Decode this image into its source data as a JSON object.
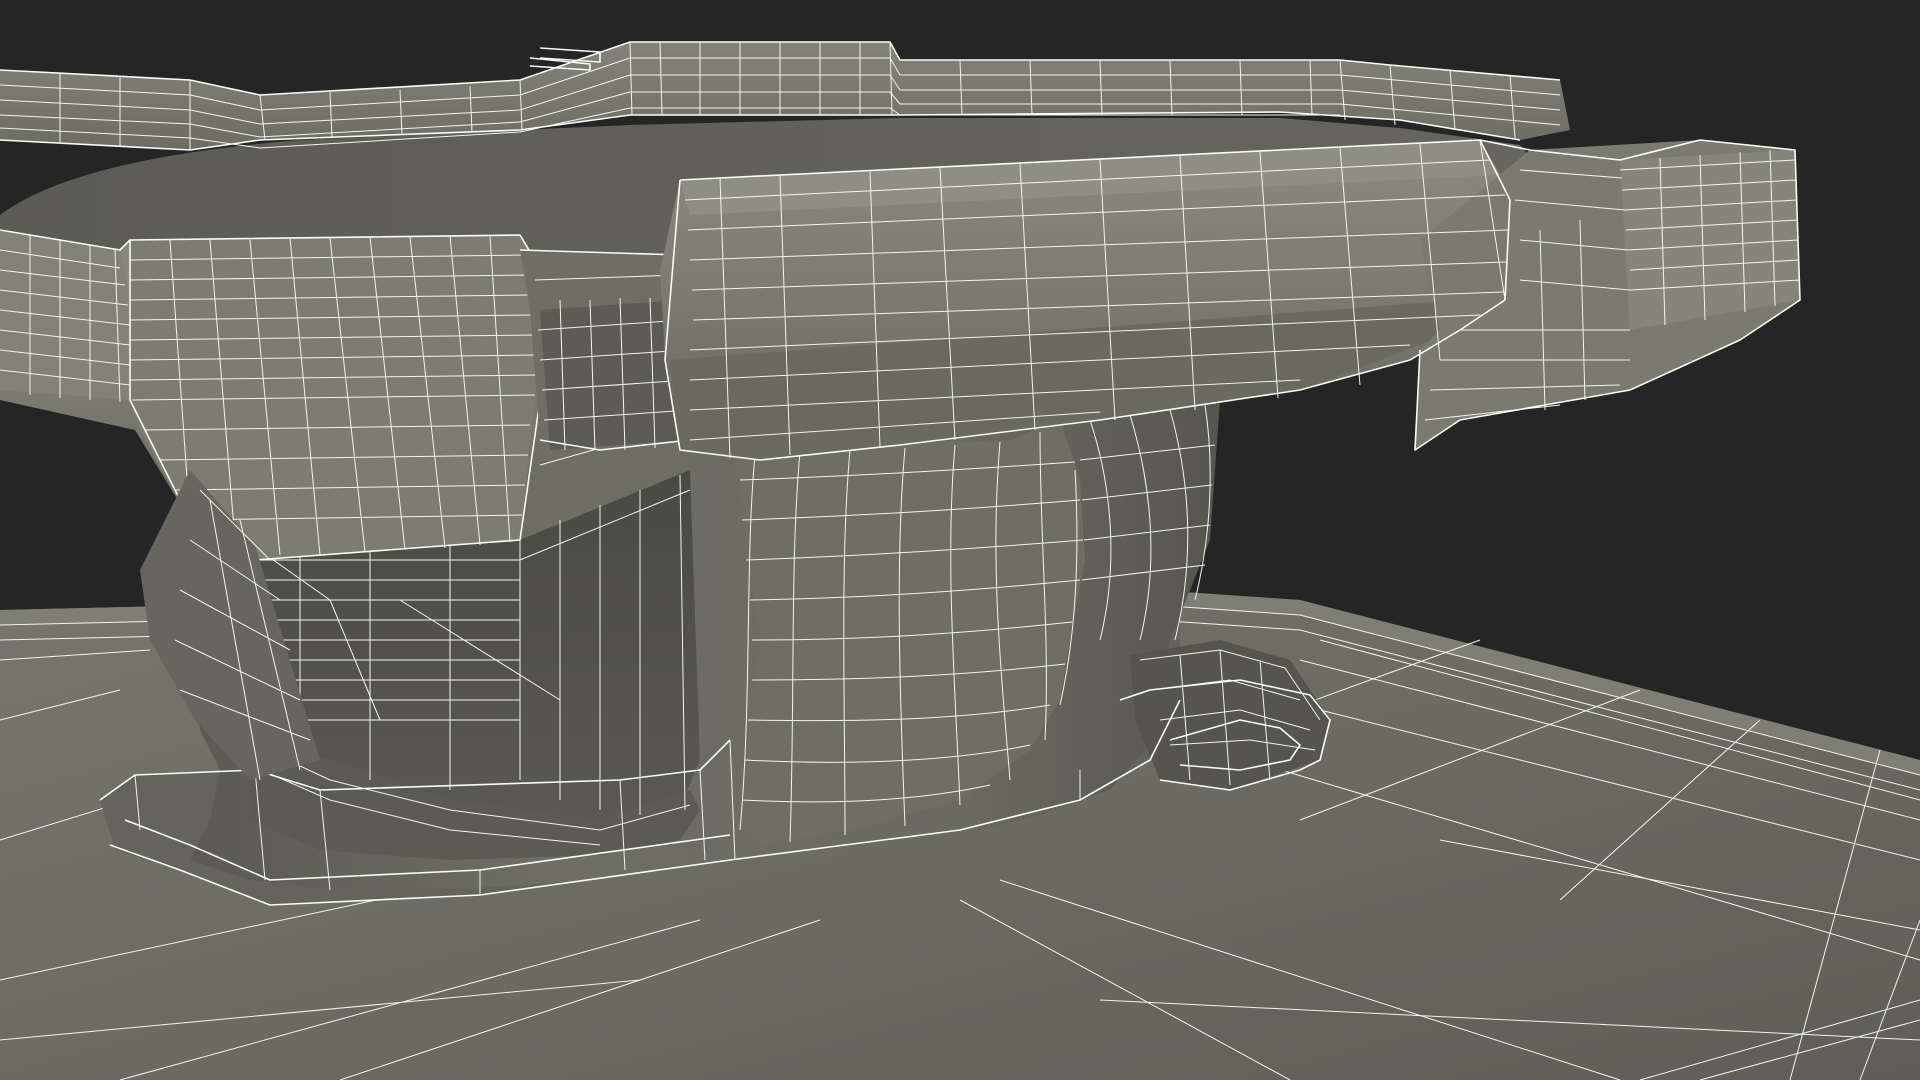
{
  "scene": {
    "background_color": "#252525",
    "surface_color": "#6f6f66",
    "surface_dark_color": "#4c4c45",
    "surface_light_color": "#84847a",
    "wire_color": "#f4f4ee"
  }
}
